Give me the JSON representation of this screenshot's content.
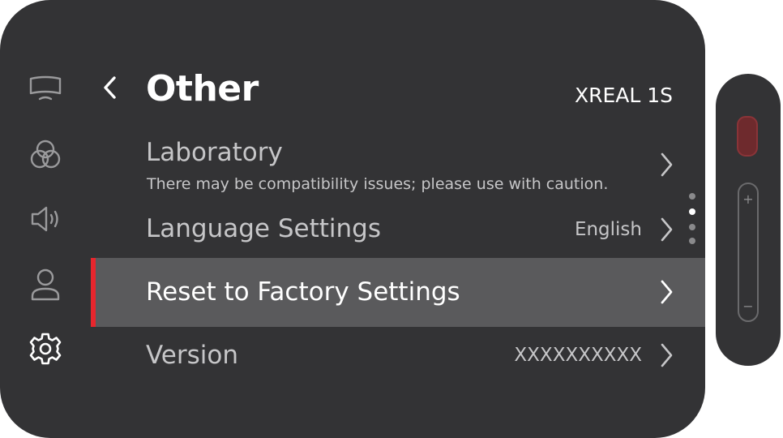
{
  "sidebar": {
    "items": [
      {
        "name": "display",
        "icon": "monitor-icon"
      },
      {
        "name": "color",
        "icon": "color-circles-icon"
      },
      {
        "name": "sound",
        "icon": "speaker-icon"
      },
      {
        "name": "account",
        "icon": "person-icon"
      },
      {
        "name": "settings",
        "icon": "gear-icon",
        "active": true
      }
    ]
  },
  "header": {
    "back_icon": "chevron-left-icon",
    "title": "Other",
    "device": "XREAL 1S"
  },
  "menu": {
    "laboratory": {
      "label": "Laboratory",
      "subtitle": "There may be compatibility issues; please use with caution."
    },
    "language": {
      "label": "Language Settings",
      "value": "English"
    },
    "reset": {
      "label": "Reset to Factory Settings",
      "selected": true
    },
    "version": {
      "label": "Version",
      "value": "XXXXXXXXXX"
    }
  },
  "scroll_indicator": {
    "count": 4,
    "active_index": 1
  },
  "remote": {
    "plus": "+",
    "minus": "−"
  },
  "colors": {
    "panel": "#333335",
    "selected_row": "#5a5a5c",
    "accent": "#e8262d",
    "text_primary": "#ffffff",
    "text_secondary": "#c6c6c8"
  }
}
